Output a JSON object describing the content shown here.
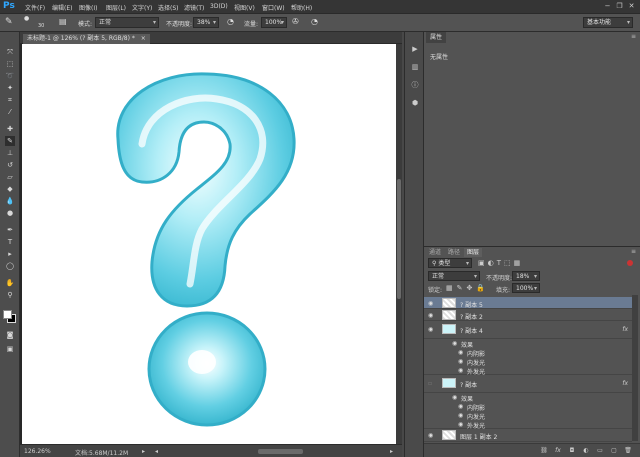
{
  "app": {
    "logo": "Ps"
  },
  "menu": [
    "文件(F)",
    "编辑(E)",
    "图像(I)",
    "图层(L)",
    "文字(Y)",
    "选择(S)",
    "滤镜(T)",
    "3D(D)",
    "视图(V)",
    "窗口(W)",
    "帮助(H)"
  ],
  "window_controls": [
    "−",
    "❐",
    "✕"
  ],
  "options": {
    "brush_size": "30",
    "mode_label": "模式:",
    "mode_value": "正常",
    "opacity_label": "不透明度:",
    "opacity_value": "38%",
    "flow_label": "流量:",
    "flow_value": "100%",
    "workspace": "基本功能"
  },
  "document": {
    "tab_title": "未标题-1 @ 126% (? 副本 5, RGB/8) *",
    "close": "×"
  },
  "status": {
    "zoom": "126.26%",
    "doc_info": "文档:5.68M/11.2M"
  },
  "properties": {
    "tab": "属性",
    "content": "无属性"
  },
  "layers_panel": {
    "tabs": [
      "通道",
      "路径",
      "图层"
    ],
    "kind_filter": "类型",
    "blend_mode": "正常",
    "opacity_label": "不透明度:",
    "opacity_value": "18%",
    "lock_label": "锁定:",
    "fill_label": "填充:",
    "fill_value": "100%",
    "rows": [
      {
        "name": "? 副本 5",
        "type": "layer"
      },
      {
        "name": "? 副本 2",
        "type": "layer"
      },
      {
        "name": "? 副本 4",
        "type": "layer",
        "fx": "fx"
      },
      {
        "name": "效果",
        "type": "effects-header"
      },
      {
        "name": "内阴影",
        "type": "effect"
      },
      {
        "name": "内发光",
        "type": "effect"
      },
      {
        "name": "外发光",
        "type": "effect"
      },
      {
        "name": "? 副本",
        "type": "layer",
        "fx": "fx"
      },
      {
        "name": "效果",
        "type": "effects-header"
      },
      {
        "name": "内阴影",
        "type": "effect"
      },
      {
        "name": "内发光",
        "type": "effect"
      },
      {
        "name": "外发光",
        "type": "effect"
      },
      {
        "name": "图层 1 副本 2",
        "type": "layer"
      }
    ]
  },
  "colors": {
    "accent": "#2fa7ff",
    "balloon": "#4fc9df",
    "balloon_light": "#a8eef7",
    "selected_layer": "#6a7b93"
  }
}
